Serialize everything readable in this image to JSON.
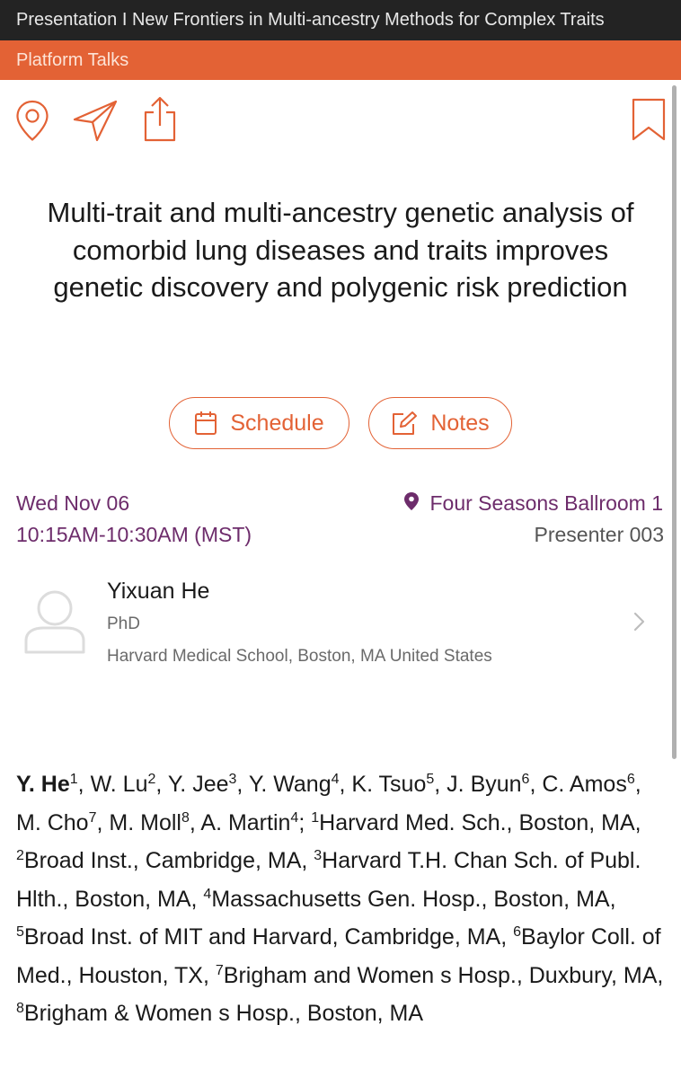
{
  "header": {
    "title": "Presentation I New Frontiers in Multi-ancestry Methods for Complex Traits",
    "category": "Platform Talks"
  },
  "toolbar": {
    "icons": [
      "location-pin-icon",
      "send-arrow-icon",
      "share-icon",
      "bookmark-icon"
    ]
  },
  "talk": {
    "title": "Multi-trait and multi-ancestry genetic analysis of comorbid lung diseases and traits improves genetic discovery and polygenic risk prediction",
    "schedule_label": "Schedule",
    "notes_label": "Notes",
    "date": "Wed Nov 06",
    "time": "10:15AM-10:30AM (MST)",
    "location": "Four Seasons Ballroom 1",
    "presenter_code": "Presenter 003"
  },
  "presenter": {
    "name": "Yixuan He",
    "degree": "PhD",
    "affiliation": "Harvard Medical School, Boston, MA United States"
  },
  "authors": [
    {
      "name": "Y. He",
      "sup": "1",
      "bold": true,
      "after": ", "
    },
    {
      "name": "W. Lu",
      "sup": "2",
      "after": ", "
    },
    {
      "name": "Y. Jee",
      "sup": "3",
      "after": ", "
    },
    {
      "name": "Y. Wang",
      "sup": "4",
      "after": ", "
    },
    {
      "name": "K. Tsuo",
      "sup": "5",
      "after": ", "
    },
    {
      "name": "J. Byun",
      "sup": "6",
      "after": ", "
    },
    {
      "name": "C. Amos",
      "sup": "6",
      "after": ", "
    },
    {
      "name": "M. Cho",
      "sup": "7",
      "after": ", "
    },
    {
      "name": "M. Moll",
      "sup": "8",
      "after": ", "
    },
    {
      "name": "A. Martin",
      "sup": "4",
      "after": "; "
    }
  ],
  "affiliations": [
    {
      "sup": "1",
      "text": "Harvard Med. Sch., Boston, MA, "
    },
    {
      "sup": "2",
      "text": "Broad Inst., Cambridge, MA, "
    },
    {
      "sup": "3",
      "text": "Harvard T.H. Chan Sch. of Publ. Hlth., Boston, MA, "
    },
    {
      "sup": "4",
      "text": "Massachusetts Gen. Hosp., Boston, MA, "
    },
    {
      "sup": "5",
      "text": "Broad Inst. of MIT and Harvard, Cambridge, MA, "
    },
    {
      "sup": "6",
      "text": "Baylor Coll. of Med., Houston, TX, "
    },
    {
      "sup": "7",
      "text": "Brigham and Women s Hosp., Duxbury, MA, "
    },
    {
      "sup": "8",
      "text": "Brigham & Women s Hosp., Boston, MA"
    }
  ],
  "colors": {
    "accent": "#e36235",
    "header_bg": "#232323",
    "purple": "#6d2c6b"
  }
}
